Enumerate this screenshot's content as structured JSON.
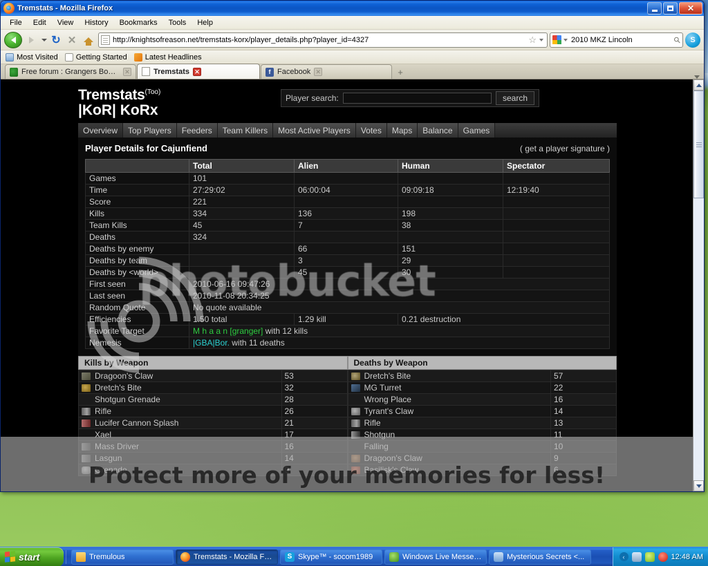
{
  "window": {
    "title": "Tremstats - Mozilla Firefox",
    "minimize_label": "Minimize",
    "maximize_label": "Maximize",
    "close_label": "Close"
  },
  "menubar": {
    "items": [
      "File",
      "Edit",
      "View",
      "History",
      "Bookmarks",
      "Tools",
      "Help"
    ]
  },
  "toolbar": {
    "back_label": "Back",
    "forward_label": "Forward",
    "reload_glyph": "↻",
    "stop_glyph": "✕",
    "home_label": "Home",
    "url": "http://knightsofreason.net/tremstats-korx/player_details.php?player_id=4327",
    "url_placeholder": "Go to a Website",
    "bookmark_star": "☆",
    "search_value": "2010 MKZ Lincoln",
    "search_placeholder": "Search",
    "search_engine": "Google",
    "skype_label": "Skype"
  },
  "bookmarks": {
    "items": [
      {
        "label": "Most Visited",
        "icon": "most-visited-icon"
      },
      {
        "label": "Getting Started",
        "icon": "document-icon"
      },
      {
        "label": "Latest Headlines",
        "icon": "rss-icon"
      }
    ]
  },
  "tabs": [
    {
      "label": "Free forum : Grangers Bouncing Aroun...",
      "active": false,
      "icon": "granger-icon"
    },
    {
      "label": "Tremstats",
      "active": true,
      "icon": "document-icon"
    },
    {
      "label": "Facebook",
      "active": false,
      "icon": "facebook-icon"
    }
  ],
  "newtab_label": "+",
  "site": {
    "brand": "Tremstats",
    "brand_sup": "(Too)",
    "brand_sub": "|KoR| KoRx",
    "search": {
      "label": "Player search:",
      "value": "",
      "placeholder": "",
      "button": "search"
    },
    "nav": [
      "Overview",
      "Top Players",
      "Feeders",
      "Team Killers",
      "Most Active Players",
      "Votes",
      "Maps",
      "Balance",
      "Games"
    ],
    "panel_title": "Player Details for Cajunfiend",
    "signature_link": "( get a player signature )",
    "stats_headers": [
      "",
      "Total",
      "Alien",
      "Human",
      "Spectator"
    ],
    "stats_rows": [
      {
        "label": "Games",
        "total": "101",
        "alien": "",
        "human": "",
        "spectator": ""
      },
      {
        "label": "Time",
        "total": "27:29:02",
        "alien": "06:00:04",
        "human": "09:09:18",
        "spectator": "12:19:40"
      },
      {
        "label": "Score",
        "total": "221",
        "alien": "",
        "human": "",
        "spectator": ""
      },
      {
        "label": "Kills",
        "total": "334",
        "alien": "136",
        "human": "198",
        "spectator": ""
      },
      {
        "label": "Team Kills",
        "total": "45",
        "alien": "7",
        "human": "38",
        "spectator": ""
      },
      {
        "label": "Deaths",
        "total": "324",
        "alien": "",
        "human": "",
        "spectator": ""
      },
      {
        "label": "Deaths by enemy",
        "total": "",
        "alien": "66",
        "human": "151",
        "spectator": ""
      },
      {
        "label": "Deaths by team",
        "total": "",
        "alien": "3",
        "human": "29",
        "spectator": ""
      },
      {
        "label": "Deaths by <world>",
        "total": "",
        "alien": "45",
        "human": "30",
        "spectator": ""
      },
      {
        "label": "First seen",
        "total": "2010-06-16 09:47:26",
        "alien": "",
        "human": "",
        "spectator": "",
        "span": true
      },
      {
        "label": "Last seen",
        "total": "2010-11-08 20:34:25",
        "alien": "",
        "human": "",
        "spectator": "",
        "span": true
      },
      {
        "label": "Random Quote",
        "total": "No quote available",
        "alien": "",
        "human": "",
        "spectator": "",
        "span": true
      },
      {
        "label": "Efficiencies",
        "total": "1.50 total",
        "alien": "1.29 kill",
        "human": "0.21 destruction",
        "spectator": ""
      }
    ],
    "favorite_target": {
      "label": "Favorite Target",
      "name": "M h a a n [granger]",
      "suffix": "with 12 kills"
    },
    "nemesis": {
      "label": "Nemesis",
      "name": "|GBA|Bor.",
      "suffix": "with 11 deaths"
    },
    "kills_by_weapon": {
      "title": "Kills by Weapon",
      "rows": [
        {
          "weapon": "Dragoon's Claw",
          "count": "53",
          "icon": "dragoon-claw-icon"
        },
        {
          "weapon": "Dretch's Bite",
          "count": "32",
          "icon": "dretch-bite-icon"
        },
        {
          "weapon": "Shotgun Grenade",
          "count": "28",
          "icon": "blank-icon"
        },
        {
          "weapon": "Rifle",
          "count": "26",
          "icon": "rifle-icon"
        },
        {
          "weapon": "Lucifer Cannon Splash",
          "count": "21",
          "icon": "lucifer-cannon-icon"
        },
        {
          "weapon": "Xael",
          "count": "17",
          "icon": "blank-icon"
        },
        {
          "weapon": "Mass Driver",
          "count": "16",
          "icon": "mass-driver-icon"
        },
        {
          "weapon": "Lasgun",
          "count": "14",
          "icon": "lasgun-icon"
        },
        {
          "weapon": "Grenade",
          "count": "9",
          "icon": "grenade-icon"
        }
      ]
    },
    "deaths_by_weapon": {
      "title": "Deaths by Weapon",
      "rows": [
        {
          "weapon": "Dretch's Bite",
          "count": "57",
          "icon": "dretch-bite-icon"
        },
        {
          "weapon": "MG Turret",
          "count": "22",
          "icon": "mg-turret-icon"
        },
        {
          "weapon": "Wrong Place",
          "count": "16",
          "icon": "blank-icon"
        },
        {
          "weapon": "Tyrant's Claw",
          "count": "14",
          "icon": "tyrant-claw-icon"
        },
        {
          "weapon": "Rifle",
          "count": "13",
          "icon": "rifle-icon"
        },
        {
          "weapon": "Shotgun",
          "count": "11",
          "icon": "shotgun-icon"
        },
        {
          "weapon": "Falling",
          "count": "10",
          "icon": "blank-icon"
        },
        {
          "weapon": "Dragoon's Claw",
          "count": "9",
          "icon": "dragoon-claw-icon"
        },
        {
          "weapon": "Basilisk's Claw",
          "count": "6",
          "icon": "basilisk-claw-icon"
        }
      ]
    }
  },
  "watermark": {
    "brand": "photobucket",
    "tagline": "Protect more of your memories for less!"
  },
  "taskbar": {
    "start_label": "start",
    "tasks": [
      {
        "label": "Tremulous",
        "icon": "folder-icon",
        "active": false
      },
      {
        "label": "Tremstats - Mozilla Fir...",
        "icon": "firefox-icon",
        "active": true
      },
      {
        "label": "Skype™ - socom1989",
        "icon": "skype-icon",
        "active": false
      },
      {
        "label": "Windows Live Messen...",
        "icon": "messenger-icon",
        "active": false
      },
      {
        "label": "Mysterious Secrets <...",
        "icon": "people-icon",
        "active": false
      }
    ],
    "tray": {
      "expand_glyph": "‹",
      "icons": [
        "network-icon",
        "security-shield-icon",
        "alert-icon"
      ],
      "clock": "12:48 AM"
    }
  },
  "colors": {
    "titlebar_blue": "#0b55c4",
    "taskbar_blue": "#1a4fb4",
    "start_green": "#4ea521",
    "site_bg": "#000000",
    "accent_green": "#2ecc40"
  }
}
